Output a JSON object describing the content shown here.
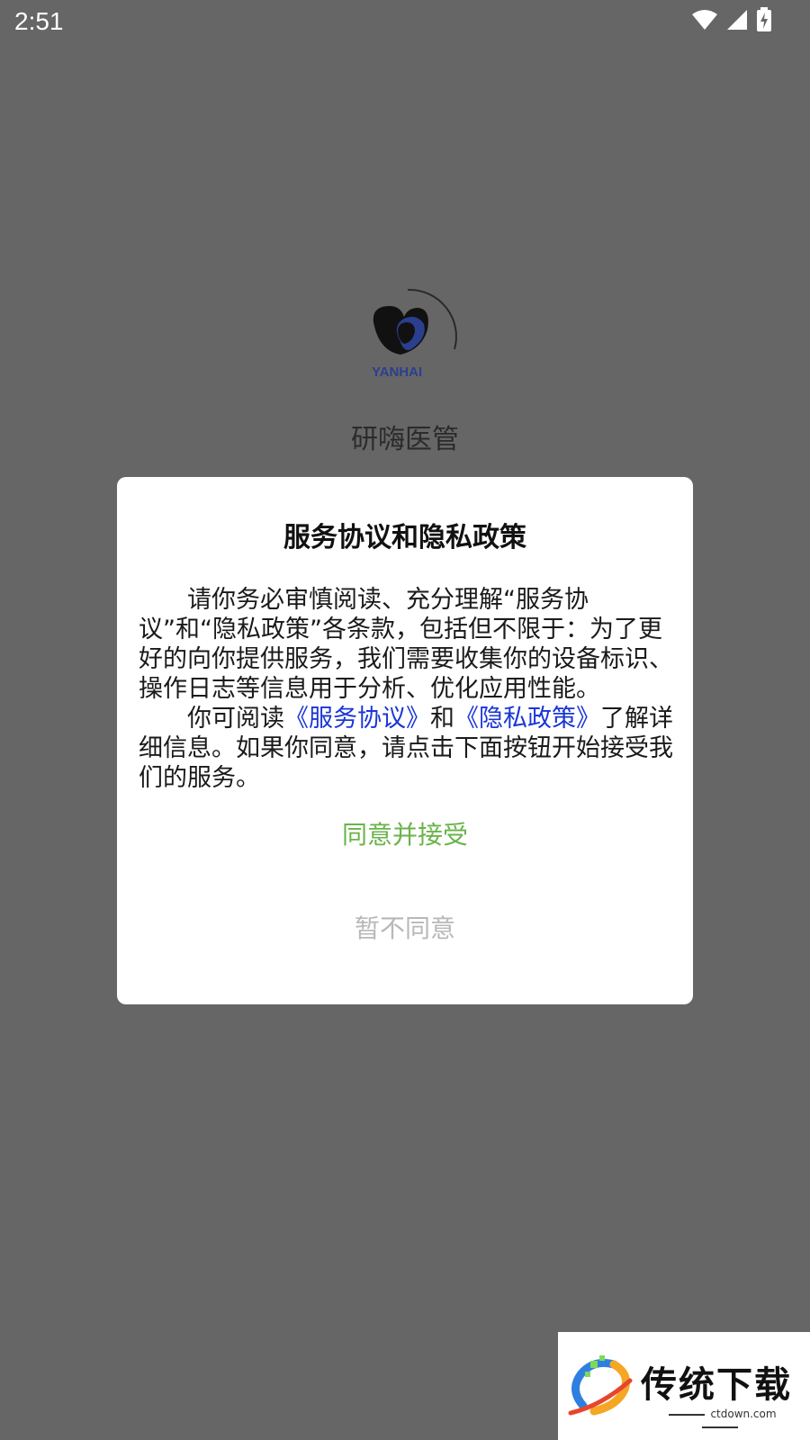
{
  "status_bar": {
    "time": "2:51",
    "icons": [
      "wifi-icon",
      "signal-icon",
      "battery-charging-icon"
    ]
  },
  "splash": {
    "logo_text": "YANHAI",
    "app_name": "研嗨医管"
  },
  "dialog": {
    "title": "服务协议和隐私政策",
    "paragraph1": "请你务必审慎阅读、充分理解“服务协议”和“隐私政策”各条款，包括但不限于：为了更好的向你提供服务，我们需要收集你的设备标识、操作日志等信息用于分析、优化应用性能。",
    "paragraph2_prefix": "你可阅读",
    "service_link": "《服务协议》",
    "paragraph2_and": "和",
    "privacy_link": "《隐私政策》",
    "paragraph2_suffix": "了解详细信息。如果你同意，请点击下面按钮开始接受我们的服务。",
    "agree_label": "同意并接受",
    "disagree_label": "暂不同意"
  },
  "watermark": {
    "text": "传统下载",
    "domain": "ctdown.com"
  },
  "colors": {
    "overlay": "#666666",
    "link": "#1a36d6",
    "agree": "#6ab34a",
    "disagree": "#b8b8b8"
  }
}
